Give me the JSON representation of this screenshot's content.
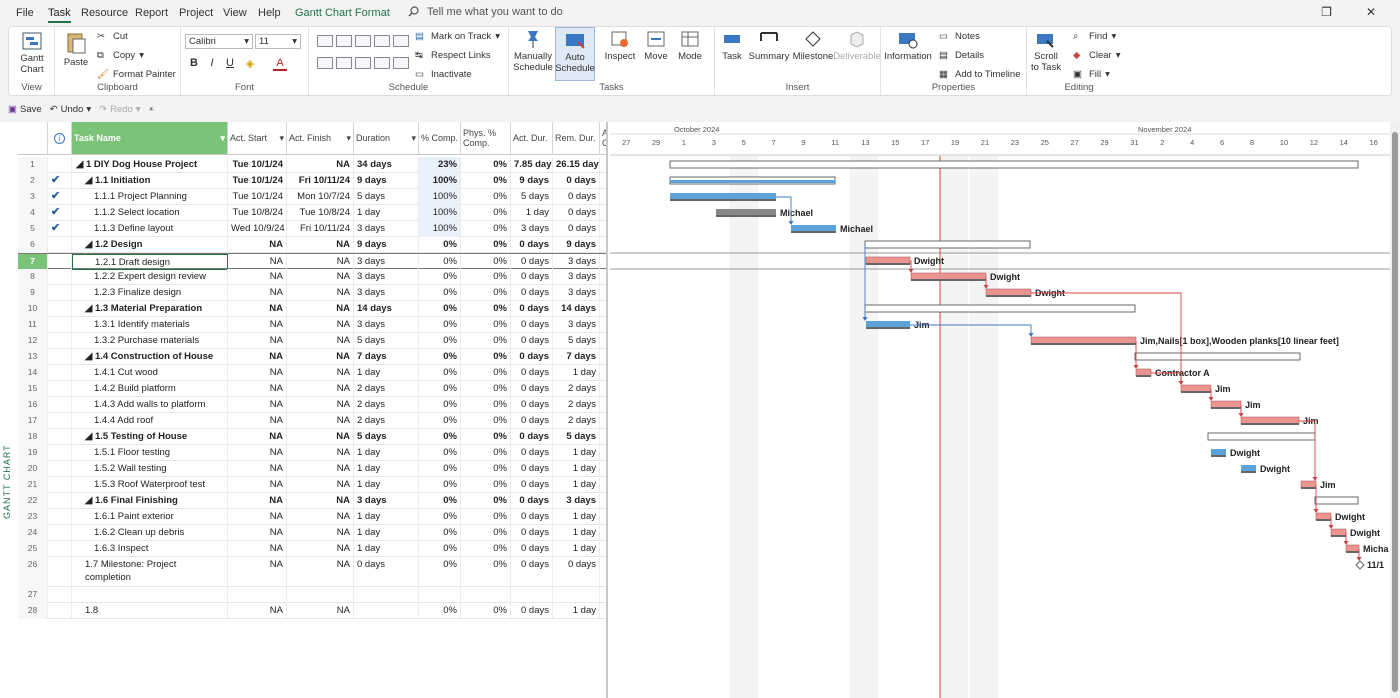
{
  "menu": [
    "File",
    "Task",
    "Resource",
    "Report",
    "Project",
    "View",
    "Help",
    "Gantt Chart Format"
  ],
  "tellme": "Tell me what you want to do",
  "ribbon": {
    "view": {
      "gantt": "Gantt Chart",
      "label": "View"
    },
    "clipboard": {
      "paste": "Paste",
      "cut": "Cut",
      "copy": "Copy",
      "format_painter": "Format Painter",
      "label": "Clipboard"
    },
    "font": {
      "name": "Calibri",
      "size": "11",
      "label": "Font"
    },
    "schedule": {
      "mark_on_track": "Mark on Track",
      "respect_links": "Respect Links",
      "inactivate": "Inactivate",
      "label": "Schedule"
    },
    "tasks": {
      "manual": "Manually Schedule",
      "auto": "Auto Schedule",
      "inspect": "Inspect",
      "move": "Move",
      "mode": "Mode",
      "label": "Tasks"
    },
    "insert": {
      "task": "Task",
      "summary": "Summary",
      "milestone": "Milestone",
      "deliverable": "Deliverable",
      "label": "Insert"
    },
    "properties": {
      "information": "Information",
      "notes": "Notes",
      "details": "Details",
      "timeline": "Add to Timeline",
      "label": "Properties"
    },
    "editing": {
      "scroll": "Scroll to Task",
      "find": "Find",
      "clear": "Clear",
      "fill": "Fill",
      "label": "Editing"
    }
  },
  "qat": {
    "save": "Save",
    "undo": "Undo",
    "redo": "Redo"
  },
  "side_label": "GANTT CHART",
  "columns": [
    "Task Name",
    "Act. Start",
    "Act. Finish",
    "Duration",
    "% Comp.",
    "Phys. % Comp.",
    "Act. Dur.",
    "Rem. Dur.",
    "A C"
  ],
  "rows": [
    {
      "n": "1",
      "chk": "",
      "name": "◢ 1 DIY Dog House Project",
      "start": "Tue 10/1/24",
      "finish": "NA",
      "dur": "34 days",
      "pc": "23%",
      "phys": "0%",
      "adur": "7.85 days",
      "rem": "26.15 days",
      "bold": true,
      "indent": 0
    },
    {
      "n": "2",
      "chk": "✔",
      "name": "◢ 1.1 Initiation",
      "start": "Tue 10/1/24",
      "finish": "Fri 10/11/24",
      "dur": "9 days",
      "pc": "100%",
      "phys": "0%",
      "adur": "9 days",
      "rem": "0 days",
      "bold": true,
      "indent": 1
    },
    {
      "n": "3",
      "chk": "✔",
      "name": "1.1.1 Project Planning",
      "start": "Tue 10/1/24",
      "finish": "Mon 10/7/24",
      "dur": "5 days",
      "pc": "100%",
      "phys": "0%",
      "adur": "5 days",
      "rem": "0 days",
      "bold": false,
      "indent": 2
    },
    {
      "n": "4",
      "chk": "✔",
      "name": "1.1.2 Select location",
      "start": "Tue 10/8/24",
      "finish": "Tue 10/8/24",
      "dur": "1 day",
      "pc": "100%",
      "phys": "0%",
      "adur": "1 day",
      "rem": "0 days",
      "bold": false,
      "indent": 2
    },
    {
      "n": "5",
      "chk": "✔",
      "name": "1.1.3 Define layout",
      "start": "Wed 10/9/24",
      "finish": "Fri 10/11/24",
      "dur": "3 days",
      "pc": "100%",
      "phys": "0%",
      "adur": "3 days",
      "rem": "0 days",
      "bold": false,
      "indent": 2
    },
    {
      "n": "6",
      "chk": "",
      "name": "◢ 1.2 Design",
      "start": "NA",
      "finish": "NA",
      "dur": "9 days",
      "pc": "0%",
      "phys": "0%",
      "adur": "0 days",
      "rem": "9 days",
      "bold": true,
      "indent": 1
    },
    {
      "n": "7",
      "chk": "",
      "name": "1.2.1 Draft design",
      "start": "NA",
      "finish": "NA",
      "dur": "3 days",
      "pc": "0%",
      "phys": "0%",
      "adur": "0 days",
      "rem": "3 days",
      "bold": false,
      "indent": 2
    },
    {
      "n": "8",
      "chk": "",
      "name": "1.2.2 Expert design review",
      "start": "NA",
      "finish": "NA",
      "dur": "3 days",
      "pc": "0%",
      "phys": "0%",
      "adur": "0 days",
      "rem": "3 days",
      "bold": false,
      "indent": 2
    },
    {
      "n": "9",
      "chk": "",
      "name": "1.2.3 Finalize design",
      "start": "NA",
      "finish": "NA",
      "dur": "3 days",
      "pc": "0%",
      "phys": "0%",
      "adur": "0 days",
      "rem": "3 days",
      "bold": false,
      "indent": 2
    },
    {
      "n": "10",
      "chk": "",
      "name": "◢ 1.3 Material Preparation",
      "start": "NA",
      "finish": "NA",
      "dur": "14 days",
      "pc": "0%",
      "phys": "0%",
      "adur": "0 days",
      "rem": "14 days",
      "bold": true,
      "indent": 1
    },
    {
      "n": "11",
      "chk": "",
      "name": "1.3.1 Identify materials",
      "start": "NA",
      "finish": "NA",
      "dur": "3 days",
      "pc": "0%",
      "phys": "0%",
      "adur": "0 days",
      "rem": "3 days",
      "bold": false,
      "indent": 2
    },
    {
      "n": "12",
      "chk": "",
      "name": "1.3.2 Purchase materials",
      "start": "NA",
      "finish": "NA",
      "dur": "5 days",
      "pc": "0%",
      "phys": "0%",
      "adur": "0 days",
      "rem": "5 days",
      "bold": false,
      "indent": 2
    },
    {
      "n": "13",
      "chk": "",
      "name": "◢ 1.4 Construction of House",
      "start": "NA",
      "finish": "NA",
      "dur": "7 days",
      "pc": "0%",
      "phys": "0%",
      "adur": "0 days",
      "rem": "7 days",
      "bold": true,
      "indent": 1
    },
    {
      "n": "14",
      "chk": "",
      "name": "1.4.1 Cut wood",
      "start": "NA",
      "finish": "NA",
      "dur": "1 day",
      "pc": "0%",
      "phys": "0%",
      "adur": "0 days",
      "rem": "1 day",
      "bold": false,
      "indent": 2
    },
    {
      "n": "15",
      "chk": "",
      "name": "1.4.2 Build platform",
      "start": "NA",
      "finish": "NA",
      "dur": "2 days",
      "pc": "0%",
      "phys": "0%",
      "adur": "0 days",
      "rem": "2 days",
      "bold": false,
      "indent": 2
    },
    {
      "n": "16",
      "chk": "",
      "name": "1.4.3 Add walls to platform",
      "start": "NA",
      "finish": "NA",
      "dur": "2 days",
      "pc": "0%",
      "phys": "0%",
      "adur": "0 days",
      "rem": "2 days",
      "bold": false,
      "indent": 2
    },
    {
      "n": "17",
      "chk": "",
      "name": "1.4.4 Add roof",
      "start": "NA",
      "finish": "NA",
      "dur": "2 days",
      "pc": "0%",
      "phys": "0%",
      "adur": "0 days",
      "rem": "2 days",
      "bold": false,
      "indent": 2
    },
    {
      "n": "18",
      "chk": "",
      "name": "◢ 1.5 Testing of House",
      "start": "NA",
      "finish": "NA",
      "dur": "5 days",
      "pc": "0%",
      "phys": "0%",
      "adur": "0 days",
      "rem": "5 days",
      "bold": true,
      "indent": 1
    },
    {
      "n": "19",
      "chk": "",
      "name": "1.5.1 Floor testing",
      "start": "NA",
      "finish": "NA",
      "dur": "1 day",
      "pc": "0%",
      "phys": "0%",
      "adur": "0 days",
      "rem": "1 day",
      "bold": false,
      "indent": 2
    },
    {
      "n": "20",
      "chk": "",
      "name": "1.5.2 Wall testing",
      "start": "NA",
      "finish": "NA",
      "dur": "1 day",
      "pc": "0%",
      "phys": "0%",
      "adur": "0 days",
      "rem": "1 day",
      "bold": false,
      "indent": 2
    },
    {
      "n": "21",
      "chk": "",
      "name": "1.5.3 Roof Waterproof test",
      "start": "NA",
      "finish": "NA",
      "dur": "1 day",
      "pc": "0%",
      "phys": "0%",
      "adur": "0 days",
      "rem": "1 day",
      "bold": false,
      "indent": 2
    },
    {
      "n": "22",
      "chk": "",
      "name": "◢ 1.6 Final Finishing",
      "start": "NA",
      "finish": "NA",
      "dur": "3 days",
      "pc": "0%",
      "phys": "0%",
      "adur": "0 days",
      "rem": "3 days",
      "bold": true,
      "indent": 1
    },
    {
      "n": "23",
      "chk": "",
      "name": "1.6.1 Paint exterior",
      "start": "NA",
      "finish": "NA",
      "dur": "1 day",
      "pc": "0%",
      "phys": "0%",
      "adur": "0 days",
      "rem": "1 day",
      "bold": false,
      "indent": 2
    },
    {
      "n": "24",
      "chk": "",
      "name": "1.6.2 Clean up debris",
      "start": "NA",
      "finish": "NA",
      "dur": "1 day",
      "pc": "0%",
      "phys": "0%",
      "adur": "0 days",
      "rem": "1 day",
      "bold": false,
      "indent": 2
    },
    {
      "n": "25",
      "chk": "",
      "name": "1.6.3 Inspect",
      "start": "NA",
      "finish": "NA",
      "dur": "1 day",
      "pc": "0%",
      "phys": "0%",
      "adur": "0 days",
      "rem": "1 day",
      "bold": false,
      "indent": 2
    },
    {
      "n": "26",
      "chk": "",
      "name": "1.7 Milestone: Project",
      "name2": "completion",
      "start": "NA",
      "finish": "NA",
      "dur": "0 days",
      "pc": "0%",
      "phys": "0%",
      "adur": "0 days",
      "rem": "0 days",
      "bold": false,
      "indent": 1
    },
    {
      "n": "27",
      "chk": "",
      "name": "",
      "start": "",
      "finish": "",
      "dur": "",
      "pc": "",
      "phys": "",
      "adur": "",
      "rem": "",
      "bold": false,
      "indent": 1
    },
    {
      "n": "28",
      "chk": "",
      "name": "1.8",
      "start": "NA",
      "finish": "NA",
      "dur": "",
      "pc": "0%",
      "phys": "0%",
      "adur": "0 days",
      "rem": "1 day",
      "bold": false,
      "indent": 1
    }
  ],
  "timescale": {
    "months": [
      "October 2024",
      "November 2024"
    ],
    "days": [
      "27",
      "29",
      "1",
      "3",
      "5",
      "7",
      "9",
      "11",
      "13",
      "15",
      "17",
      "19",
      "21",
      "23",
      "25",
      "27",
      "29",
      "31",
      "2",
      "4",
      "6",
      "8",
      "10",
      "12",
      "14",
      "16"
    ]
  },
  "bar_labels": [
    "Michael",
    "Michael",
    "Dwight",
    "Dwight",
    "Dwight",
    "Jim",
    "Jim,Nails[1 box],Wooden planks[10 linear feet]",
    "Contractor A",
    "Jim",
    "Jim",
    "Jim",
    "Dwight",
    "Dwight",
    "Jim",
    "Dwight",
    "Dwight",
    "Micha",
    "11/1"
  ],
  "colors": {
    "accent": "#217346",
    "selected": "#7cc37a",
    "task_bar": "#e8948f",
    "progress": "#5ba3d9",
    "today_line": "#d04040"
  }
}
